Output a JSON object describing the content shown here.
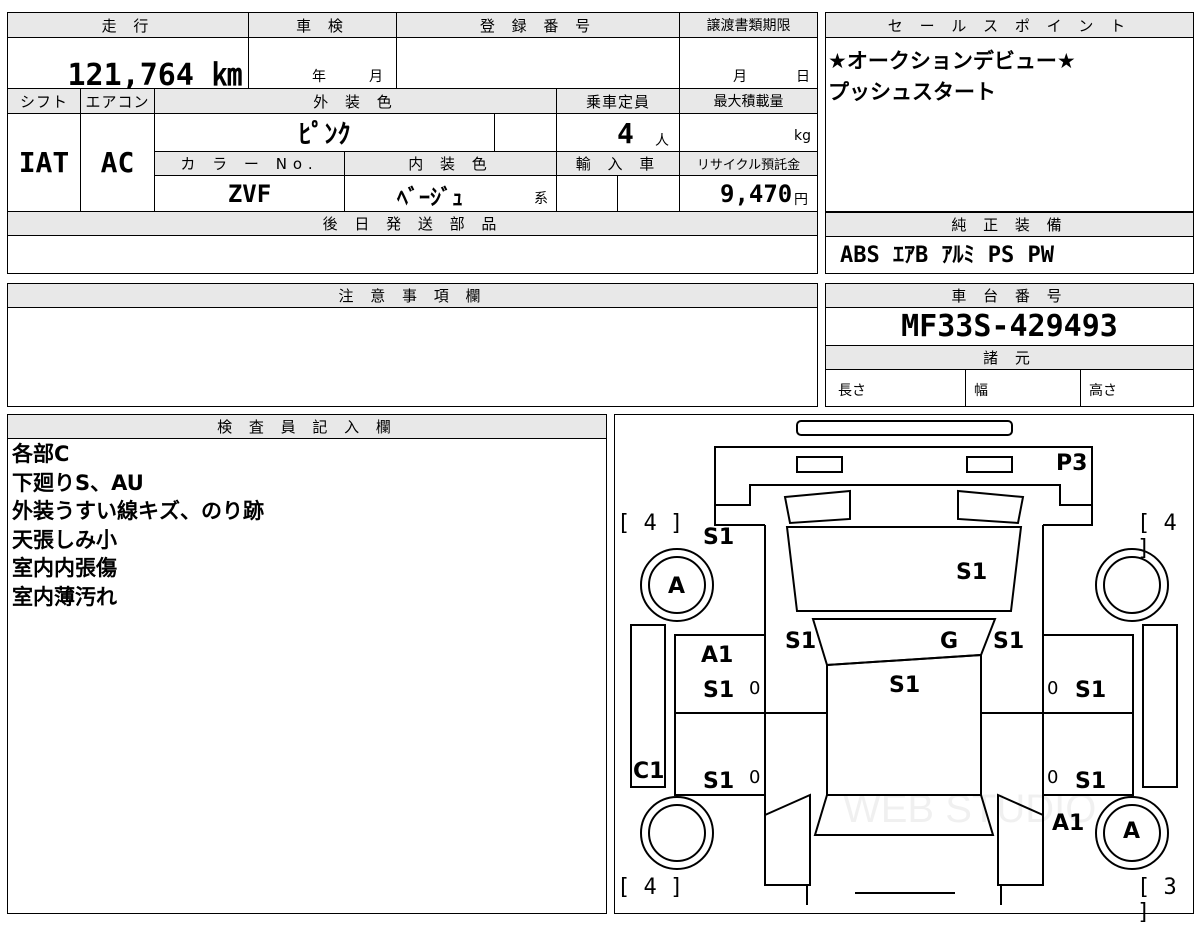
{
  "vehicle": {
    "mileage_header": "走 行",
    "mileage": "121,764 ㎞",
    "inspection_header": "車 検",
    "inspection_year_unit": "年",
    "inspection_month_unit": "月",
    "registration_header": "登 録 番 号",
    "transfer_header": "譲渡書類期限",
    "transfer_month_unit": "月",
    "transfer_day_unit": "日",
    "shift_header": "シフト",
    "shift": "IAT",
    "ac_header": "エアコン",
    "ac": "AC",
    "exterior_color_header": "外 装 色",
    "exterior_color": "ﾋﾟﾝｸ",
    "capacity_header": "乗車定員",
    "capacity": "4",
    "capacity_unit": "人",
    "max_load_header": "最大積載量",
    "max_load_unit": "kg",
    "color_no_header": "カ ラ ー No.",
    "color_no": "ZVF",
    "interior_color_header": "内 装 色",
    "interior_color": "ﾍﾞｰｼﾞｭ",
    "interior_color_suffix": "系",
    "import_header": "輸 入 車",
    "recycle_header": "リサイクル預託金",
    "recycle_fee": "9,470",
    "recycle_unit": "円"
  },
  "later_parts_header": "後 日 発 送 部 品",
  "sales_point": {
    "header": "セ ー ル ス ポ イ ン ト",
    "lines": [
      "★オークションデビュー★",
      "プッシュスタート"
    ]
  },
  "equipment": {
    "header": "純 正 装 備",
    "items": "ABS ｴｱB ｱﾙﾐ PS PW"
  },
  "caution_header": "注 意 事 項 欄",
  "chassis": {
    "header": "車 台 番 号",
    "number": "MF33S-429493"
  },
  "specs": {
    "header": "諸 元",
    "length": "長さ",
    "width": "幅",
    "height": "高さ"
  },
  "inspector": {
    "header": "検 査 員 記 入 欄",
    "notes": [
      "各部C",
      "下廻りS、AU",
      "外装うすい線キズ、のり跡",
      "天張しみ小",
      "室内内張傷",
      "室内薄汚れ"
    ]
  },
  "diagram": {
    "tires": {
      "front_left": "[ 4 ]",
      "front_right": "[ 4 ]",
      "rear_left": "[ 4 ]",
      "rear_right": "[ 3 ]"
    },
    "marks": {
      "front_bumper": "P3",
      "front_left_fender": "S1",
      "hood": "S1",
      "left_front_wheel": "A",
      "windshield_left": "S1",
      "windshield": "G",
      "windshield_right": "S1",
      "left_front_door_1": "A1",
      "left_front_door_2": "S1",
      "left_front_door_num": "0",
      "roof": "S1",
      "right_front_door": "S1",
      "right_front_door_num": "0",
      "left_sill": "C1",
      "left_rear_door": "S1",
      "left_rear_door_num": "0",
      "right_rear_door": "S1",
      "right_rear_door_num": "0",
      "right_rear_fender": "A1",
      "right_rear_wheel": "A"
    },
    "watermark": "WEB STUDIO"
  }
}
